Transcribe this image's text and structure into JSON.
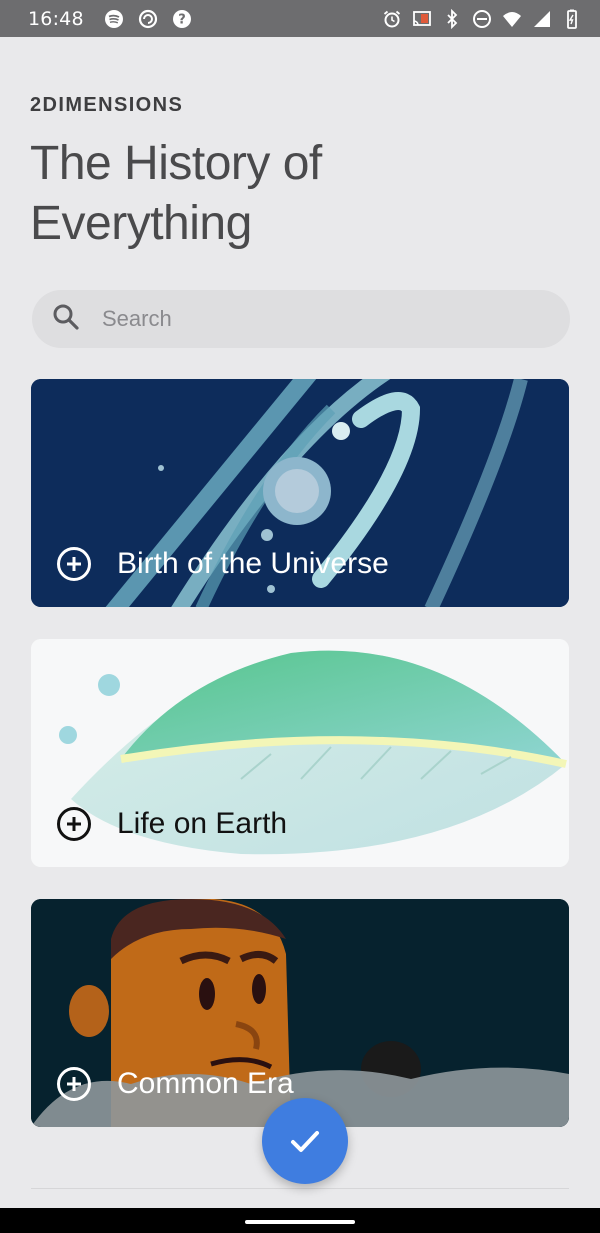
{
  "status_bar": {
    "time": "16:48",
    "left_icons": [
      "spotify-icon",
      "sync-icon",
      "help-icon"
    ],
    "right_icons": [
      "alarm-icon",
      "cast-icon",
      "bluetooth-icon",
      "do-not-disturb-icon",
      "wifi-icon",
      "signal-icon",
      "battery-icon"
    ]
  },
  "header": {
    "brand": "2DIMENSIONS",
    "title": "The History of Everything"
  },
  "search": {
    "placeholder": "Search"
  },
  "cards": [
    {
      "title": "Birth of the Universe"
    },
    {
      "title": "Life on Earth"
    },
    {
      "title": "Common Era"
    }
  ],
  "fab": {
    "icon": "check-icon"
  },
  "colors": {
    "background": "#e9e9eb",
    "universe_card": "#0d2c5b",
    "life_card": "#f7f8f9",
    "era_card": "#06222e",
    "fab": "#3f7de0"
  }
}
